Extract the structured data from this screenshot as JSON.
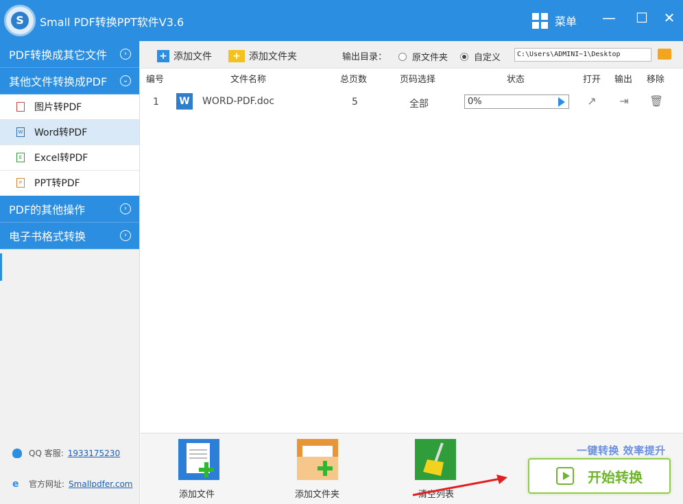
{
  "app": {
    "title": "Small PDF转换PPT软件V3.6",
    "logo_letter": "S",
    "menu_label": "菜单"
  },
  "window_controls": {
    "minimize": "—",
    "maximize": "☐",
    "close": "✕"
  },
  "sidebar": {
    "cat1": "PDF转换成其它文件",
    "cat2": "其他文件转换成PDF",
    "items": [
      {
        "label": "图片转PDF",
        "icon": "image-file-icon"
      },
      {
        "label": "Word转PDF",
        "icon": "word-file-icon"
      },
      {
        "label": "Excel转PDF",
        "icon": "excel-file-icon"
      },
      {
        "label": "PPT转PDF",
        "icon": "ppt-file-icon"
      }
    ],
    "cat3": "PDF的其他操作",
    "cat4": "电子书格式转换",
    "qq_label": "QQ 客服:",
    "qq_number": "1933175230",
    "site_label": "官方网址:",
    "site_url": "Smallpdfer.com"
  },
  "toolbar": {
    "add_file": "添加文件",
    "add_folder": "添加文件夹",
    "output_label": "输出目录：",
    "radio_original": "原文件夹",
    "radio_custom": "自定义",
    "path": "C:\\Users\\ADMINI~1\\Desktop"
  },
  "table": {
    "headers": {
      "no": "编号",
      "name": "文件名称",
      "pages": "总页数",
      "range": "页码选择",
      "status": "状态",
      "open": "打开",
      "output": "输出",
      "remove": "移除"
    },
    "rows": [
      {
        "no": "1",
        "name": "WORD-PDF.doc",
        "pages": "5",
        "range": "全部",
        "progress": "0%",
        "icon_letter": "W"
      }
    ]
  },
  "bottom": {
    "add_file": "添加文件",
    "add_folder": "添加文件夹",
    "clear": "清空列表",
    "slogan": "一键转换  效率提升",
    "start": "开始转换"
  },
  "colors": {
    "accent": "#2b8ee0",
    "start_green": "#6eb52c"
  }
}
